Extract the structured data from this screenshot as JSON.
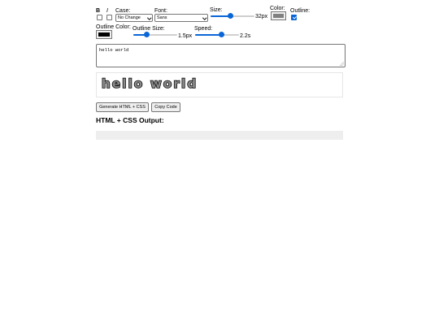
{
  "toolbar": {
    "bold_label": "B",
    "italic_label": "I",
    "bold_checked": false,
    "italic_checked": false,
    "case": {
      "label": "Case:",
      "value": "No Change"
    },
    "font": {
      "label": "Font:",
      "value": "Sans"
    },
    "size": {
      "label": "Size:",
      "value_label": "32px",
      "value": 32,
      "fraction": 0.45
    },
    "color": {
      "label": "Color:",
      "value": "#808080"
    },
    "outline": {
      "label": "Outline:",
      "checked": true
    },
    "outline_color": {
      "label": "Outline Color:",
      "value": "#000000"
    },
    "outline_size": {
      "label": "Outline Size:",
      "value_label": "1.5px",
      "value": 1.5,
      "fraction": 0.3
    },
    "speed": {
      "label": "Speed:",
      "value_label": "2.2s",
      "value": 2.2,
      "fraction": 0.6
    }
  },
  "editor": {
    "text": "hello world"
  },
  "preview": {
    "text": "hello world"
  },
  "buttons": {
    "generate_label": "Generate HTML + CSS",
    "copy_label": "Copy Code"
  },
  "output": {
    "heading": "HTML + CSS Output:",
    "code": ""
  },
  "colors": {
    "accent": "#0a66d6",
    "text_fill": "#808080",
    "text_stroke": "#000000"
  }
}
